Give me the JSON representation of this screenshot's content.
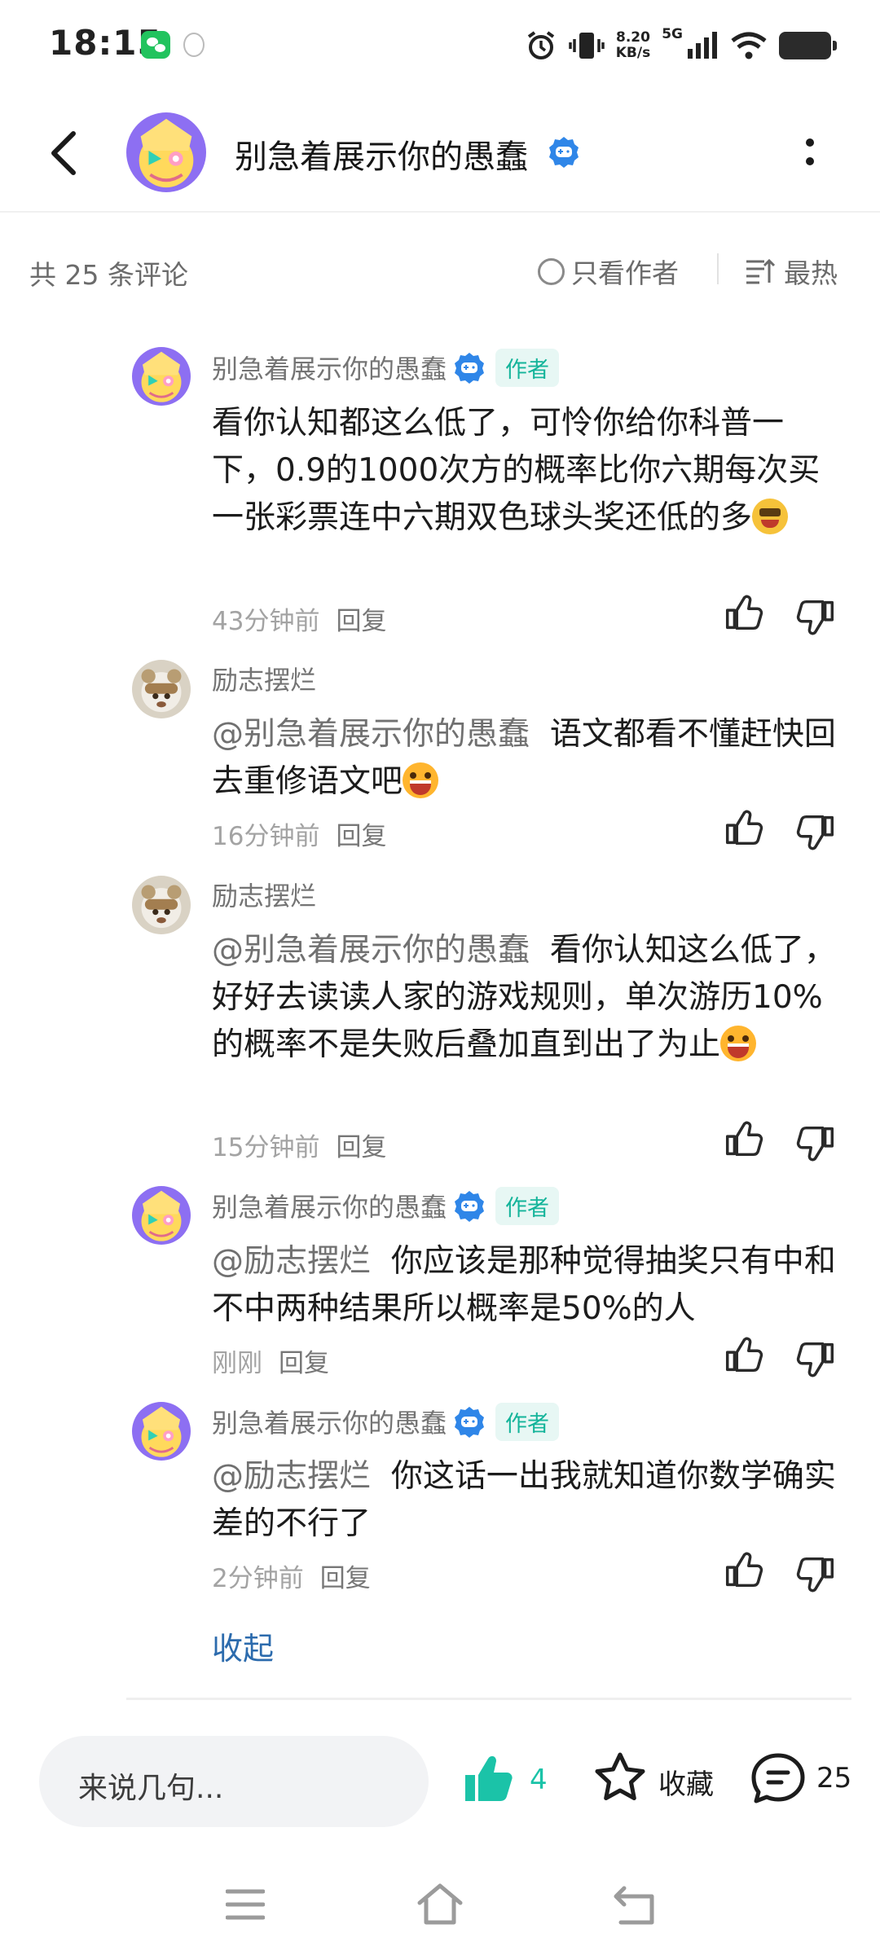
{
  "status_bar": {
    "time": "18:15",
    "net_speed_value": "8.20",
    "net_speed_unit": "KB/s",
    "network_type": "5G",
    "icons": [
      "wechat-icon",
      "notification-icon",
      "alarm-icon",
      "vibrate-icon",
      "signal-icon",
      "wifi-icon",
      "battery-icon"
    ]
  },
  "header": {
    "title": "别急着展示你的愚蠢"
  },
  "comment_bar": {
    "count": "共 25 条评论",
    "only_author": "只看作者",
    "sort": "最热"
  },
  "comments": [
    {
      "user": "别急着展示你的愚蠢",
      "author_tag": "作者",
      "text": "看你认知都这么低了，可怜你给你科普一下，0.9的1000次方的概率比你六期每次买一张彩票连中六期双色球头奖还低的多",
      "time": "43分钟前",
      "reply": "回复"
    },
    {
      "user": "励志摆烂",
      "mention": "@别急着展示你的愚蠢",
      "text": "语文都看不懂赶快回去重修语文吧",
      "time": "16分钟前",
      "reply": "回复"
    },
    {
      "user": "励志摆烂",
      "mention": "@别急着展示你的愚蠢",
      "text": "看你认知这么低了，好好去读读人家的游戏规则，单次游历10%的概率不是失败后叠加直到出了为止",
      "time": "15分钟前",
      "reply": "回复"
    },
    {
      "user": "别急着展示你的愚蠢",
      "author_tag": "作者",
      "mention": "@励志摆烂",
      "text": "你应该是那种觉得抽奖只有中和不中两种结果所以概率是50%的人",
      "time": "刚刚",
      "reply": "回复"
    },
    {
      "user": "别急着展示你的愚蠢",
      "author_tag": "作者",
      "mention": "@励志摆烂",
      "text": "你这话一出我就知道你数学确实差的不行了",
      "time": "2分钟前",
      "reply": "回复"
    }
  ],
  "collapse_label": "收起",
  "bottom_bar": {
    "input_placeholder": "来说几句...",
    "like_count": "4",
    "favorite_label": "收藏",
    "comment_count": "25"
  },
  "colors": {
    "accent": "#14b49a",
    "link": "#2c6bad",
    "verified": "#2f86e8"
  }
}
